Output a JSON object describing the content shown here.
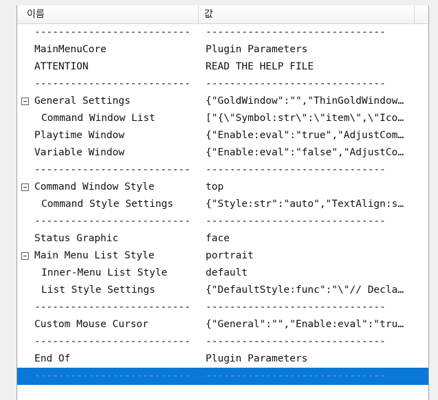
{
  "header": {
    "name_col": "이름",
    "value_col": "값"
  },
  "rows": [
    {
      "name": "--------------------------",
      "value": "------------------------------"
    },
    {
      "name": "MainMenuCore",
      "value": "Plugin Parameters"
    },
    {
      "name": "ATTENTION",
      "value": "READ THE HELP FILE"
    },
    {
      "name": "--------------------------",
      "value": "------------------------------"
    },
    {
      "name": "General Settings",
      "value": "{\"GoldWindow\":\"\",\"ThinGoldWindow…"
    },
    {
      "name": "Command Window List",
      "value": "[\"{\\\"Symbol:str\\\":\\\"item\\\",\\\"Ico…"
    },
    {
      "name": "Playtime Window",
      "value": "{\"Enable:eval\":\"true\",\"AdjustCom…"
    },
    {
      "name": "Variable Window",
      "value": "{\"Enable:eval\":\"false\",\"AdjustCo…"
    },
    {
      "name": "--------------------------",
      "value": "------------------------------"
    },
    {
      "name": "Command Window Style",
      "value": "top"
    },
    {
      "name": "Command Style Settings",
      "value": "{\"Style:str\":\"auto\",\"TextAlign:s…"
    },
    {
      "name": "--------------------------",
      "value": "------------------------------"
    },
    {
      "name": "Status Graphic",
      "value": "face"
    },
    {
      "name": "Main Menu List Style",
      "value": "portrait"
    },
    {
      "name": "Inner-Menu List Style",
      "value": "default"
    },
    {
      "name": "List Style Settings",
      "value": "{\"DefaultStyle:func\":\"\\\"// Decla…"
    },
    {
      "name": "--------------------------",
      "value": "------------------------------"
    },
    {
      "name": "Custom Mouse Cursor",
      "value": "{\"General\":\"\",\"Enable:eval\":\"tru…"
    },
    {
      "name": "--------------------------",
      "value": "------------------------------"
    },
    {
      "name": "End Of",
      "value": "Plugin Parameters"
    },
    {
      "name": "--------------------------",
      "value": "------------------------------"
    }
  ],
  "selected_row": 20
}
